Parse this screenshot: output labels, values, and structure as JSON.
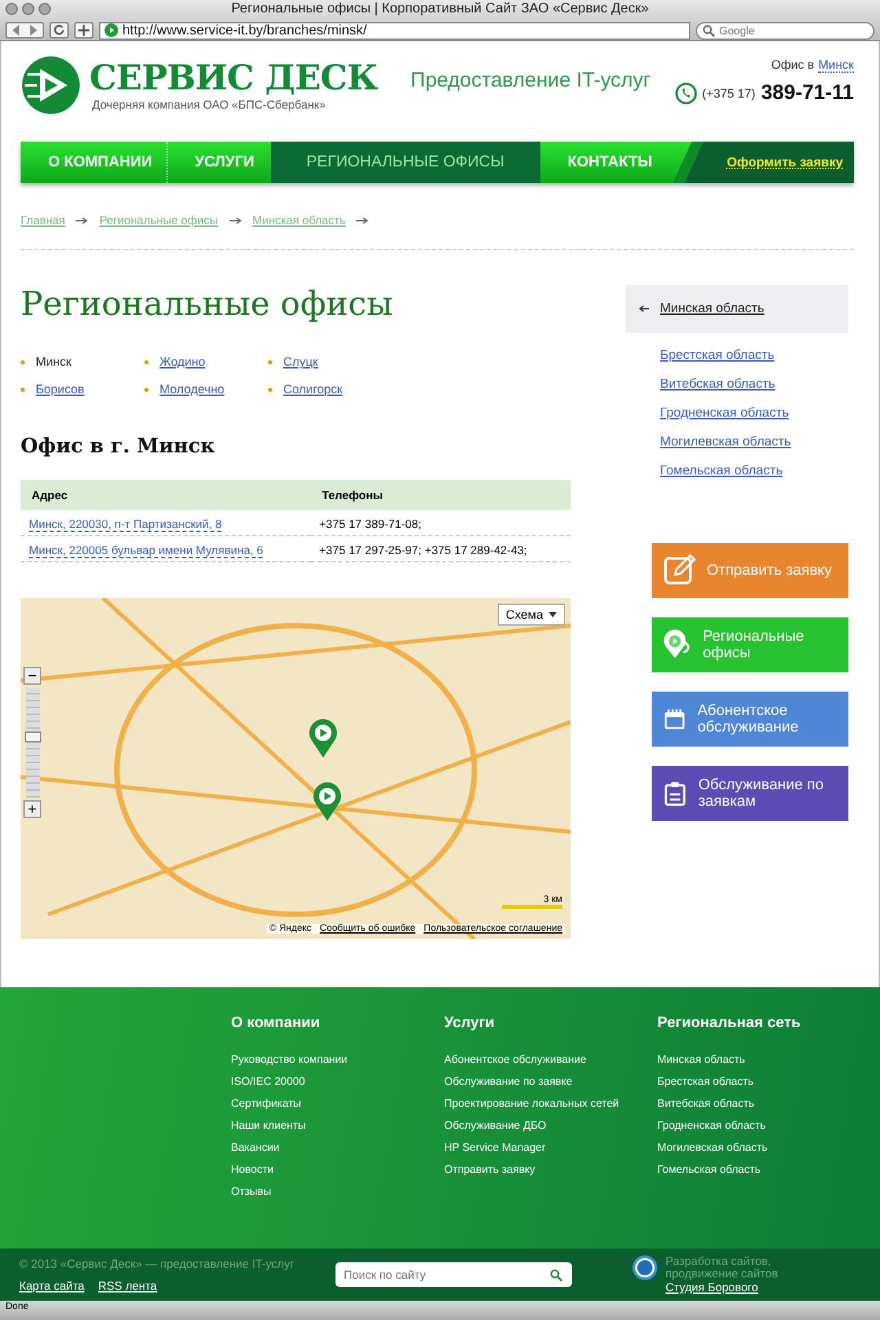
{
  "browser": {
    "title": "Региональные офисы | Корпоративный Сайт ЗАО «Сервис Деск»",
    "url": "http://www.service-it.by/branches/minsk/",
    "search_placeholder": "Google",
    "status": "Done"
  },
  "header": {
    "logo_title": "СЕРВИС ДЕСК",
    "logo_subtitle": "Дочерняя компания ОАО «БПС-Сбербанк»",
    "tagline": "Предоставление IT-услуг",
    "office_label": "Офис в",
    "office_city": "Минск",
    "phone_code": "(+375 17)",
    "phone": "389-71-11"
  },
  "nav": {
    "items": [
      {
        "label": "О КОМПАНИИ",
        "selected": false
      },
      {
        "label": "УСЛУГИ",
        "selected": false
      },
      {
        "label": "РЕГИОНАЛЬНЫЕ ОФИСЫ",
        "selected": true
      },
      {
        "label": "КОНТАКТЫ",
        "selected": false
      }
    ],
    "cta": "Оформить заявку"
  },
  "breadcrumbs": [
    "Главная",
    "Региональные офисы",
    "Минская область"
  ],
  "title": "Региональные офисы",
  "cities": [
    {
      "name": "Минск",
      "selected": true
    },
    {
      "name": "Жодино",
      "selected": false
    },
    {
      "name": "Слуцк",
      "selected": false
    },
    {
      "name": "Борисов",
      "selected": false
    },
    {
      "name": "Молодечно",
      "selected": false
    },
    {
      "name": "Солигорск",
      "selected": false
    }
  ],
  "office_heading": "Офис в г. Минск",
  "table": {
    "columns": [
      "Адрес",
      "Телефоны"
    ],
    "rows": [
      [
        "Минск, 220030, п-т Партизанский, 8",
        "+375 17 389-71-08;"
      ],
      [
        "Минск, 220005 бульвар имени Мулявина, 6",
        "+375 17 297-25-97; +375 17 289-42-43;"
      ]
    ]
  },
  "map": {
    "zoom": {
      "level": 0.55
    },
    "type_button": "Схема",
    "zoom_out": "−",
    "zoom_in": "+",
    "scale": "3 км",
    "copyright": "© Яндекс",
    "report": "Сообщить об ошибке",
    "terms": "Пользовательское соглашение"
  },
  "sidebar": {
    "regions": [
      {
        "label": "Минская область",
        "selected": true
      },
      {
        "label": "Брестская область",
        "selected": false
      },
      {
        "label": "Витебская область",
        "selected": false
      },
      {
        "label": "Гродненская область",
        "selected": false
      },
      {
        "label": "Могилевская область",
        "selected": false
      },
      {
        "label": "Гомельская область",
        "selected": false
      }
    ],
    "actions": [
      {
        "label": "Отправить заявку",
        "kind": "edit",
        "color": "#e8852e"
      },
      {
        "label": "Региональные офисы",
        "kind": "pin",
        "color": "#27c232"
      },
      {
        "label": "Абонентское обслуживание",
        "kind": "calendar",
        "color": "#4f86d6"
      },
      {
        "label": "Обслуживание по заявкам",
        "kind": "clipboard",
        "color": "#5b4bb3"
      }
    ]
  },
  "footer": {
    "columns": [
      {
        "title": "О компании",
        "links": [
          "Руководство компании",
          "ISO/IEC 20000",
          "Сертификаты",
          "Наши клиенты",
          "Вакансии",
          "Новости",
          "Отзывы"
        ]
      },
      {
        "title": "Услуги",
        "links": [
          "Абонентское обслуживание",
          "Обслуживание по заявке",
          "Проектирование локальных сетей",
          "Обслуживание ДБО",
          "HP Service Manager",
          "Отправить заявку"
        ]
      },
      {
        "title": "Региональная сеть",
        "links": [
          "Минская область",
          "Брестская область",
          "Витебская область",
          "Гродненская область",
          "Могилевская область",
          "Гомельская область"
        ]
      }
    ],
    "copyright": "© 2013 «Сервис Деск» — предоставление IT-услуг",
    "links": [
      "Карта сайта",
      "RSS лента"
    ],
    "search_placeholder": "Поиск по сайту",
    "dev_text": "Разработка сайтов, продвижение сайтов",
    "dev_link": "Студия Борового"
  }
}
